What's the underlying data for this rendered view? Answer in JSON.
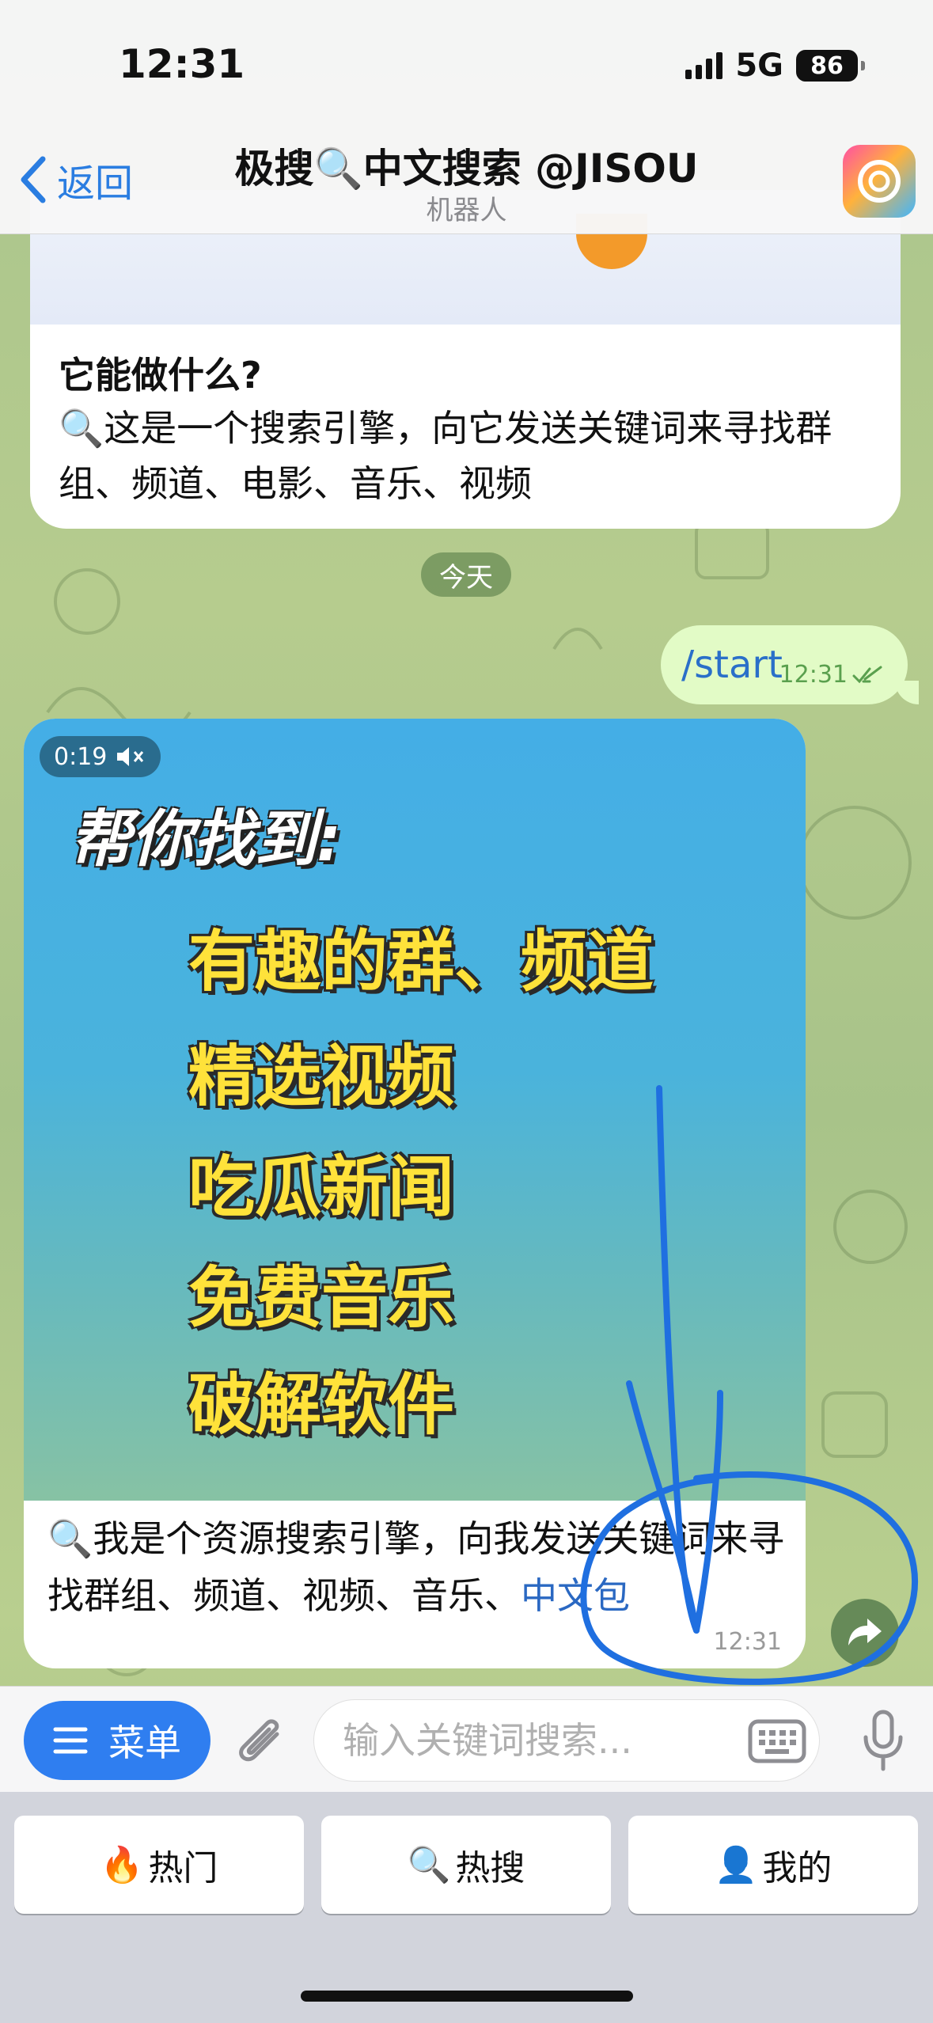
{
  "status_bar": {
    "time": "12:31",
    "network": "5G",
    "battery": "86"
  },
  "header": {
    "back_label": "返回",
    "title": "极搜🔍中文搜索 @JISOU",
    "subtitle": "机器人"
  },
  "messages": {
    "intro": {
      "heading": "它能做什么?",
      "body": "🔍这是一个搜索引擎，向它发送关键词来寻找群组、频道、电影、音乐、视频"
    },
    "date_separator": "今天",
    "outgoing": {
      "text": "/start",
      "time": "12:31"
    },
    "media": {
      "duration": "0:19",
      "video_title": "帮你找到:",
      "video_lines": [
        "有趣的群、频道",
        "精选视频",
        "吃瓜新闻",
        "免费音乐",
        "破解软件"
      ],
      "caption_text": "🔍我是个资源搜索引擎，向我发送关键词来寻找群组、频道、视频、音乐、",
      "caption_link": "中文包",
      "time": "12:31"
    }
  },
  "input_bar": {
    "menu_label": "菜单",
    "placeholder": "输入关键词搜索..."
  },
  "keyboard_buttons": [
    {
      "icon": "🔥",
      "label": "热门"
    },
    {
      "icon": "🔍",
      "label": "热搜"
    },
    {
      "icon": "👤",
      "label": "我的"
    }
  ],
  "colors": {
    "accent": "#2f7ef0",
    "outgoing_bubble": "#e2fbc6",
    "annotation": "#1f6fe0",
    "video_text": "#ffe23a"
  }
}
